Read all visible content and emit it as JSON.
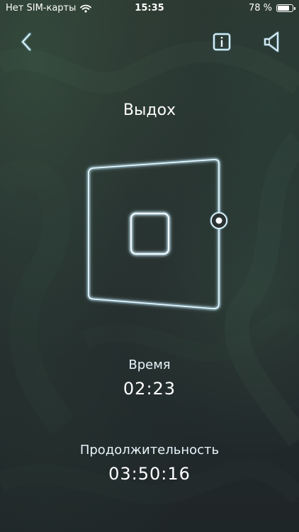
{
  "status_bar": {
    "carrier": "Нет SIM-карты",
    "time": "15:35",
    "battery_percent_label": "78 %",
    "battery_level": 0.78
  },
  "nav": {
    "back_icon": "chevron-left-icon",
    "info_icon": "info-icon",
    "sound_icon": "speaker-icon"
  },
  "exercise": {
    "phase": "Выдох",
    "time_label": "Время",
    "time_value": "02:23",
    "duration_label": "Продолжительность",
    "duration_value": "03:50:16"
  },
  "colors": {
    "glow": "#8fdcff",
    "stroke": "#e8f8ff",
    "background": "#252d2e"
  }
}
